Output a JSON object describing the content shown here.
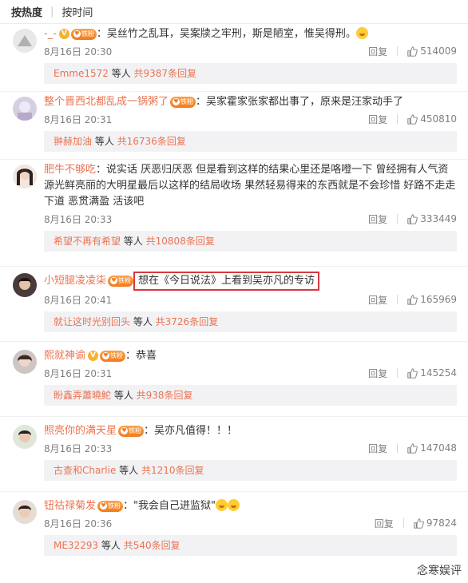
{
  "sort": {
    "hot": "按热度",
    "time": "按时间"
  },
  "comments": [
    {
      "user": "-_-",
      "text": "：吴丝竹之乱耳，吴案牍之牢刑，斯是陋室，惟吴得刑。",
      "time": "8月16日 20:30",
      "reply_label": "回复",
      "likes": "514009",
      "summary": {
        "name": "Emme1572",
        "mid": " 等人 ",
        "link": "共9387条回复"
      }
    },
    {
      "user": "整个晋西北都乱成一锅粥了",
      "text": "：吴家霍家张家都出事了，原来是汪家动手了",
      "time": "8月16日 20:31",
      "reply_label": "回复",
      "likes": "450810",
      "summary": {
        "name": "翀赫加油",
        "mid": " 等人 ",
        "link": "共16736条回复"
      }
    },
    {
      "user": "肥牛不够吃",
      "text": "：说实话 厌恶归厌恶 但是看到这样的结果心里还是咯噔一下 曾经拥有人气资源光鲜亮丽的大明星最后以这样的结局收场 果然轻易得来的东西就是不会珍惜 好路不走走下道 恶贯满盈 活该吧",
      "time": "8月16日 20:33",
      "reply_label": "回复",
      "likes": "333449",
      "summary": {
        "name": "希望不再有希望",
        "mid": " 等人 ",
        "link": "共10808条回复"
      }
    },
    {
      "user": "小短腿凌凌柒",
      "text": "想在《今日说法》上看到吴亦凡的专访",
      "time": "8月16日 20:41",
      "reply_label": "回复",
      "likes": "165969",
      "summary": {
        "name": "就让这时光别回头",
        "mid": " 等人 ",
        "link": "共3726条回复"
      }
    },
    {
      "user": "熙就神谕",
      "text": "：恭喜",
      "time": "8月16日 20:31",
      "reply_label": "回复",
      "likes": "145254",
      "summary": {
        "name": "盼鑫弄蕭曉鮀",
        "mid": " 等人 ",
        "link": "共938条回复"
      }
    },
    {
      "user": "照亮你的满天星",
      "text": "：吴亦凡值得！！！",
      "time": "8月16日 20:33",
      "reply_label": "回复",
      "likes": "147048",
      "summary": {
        "name": "古查和Charlie",
        "mid": " 等人 ",
        "link": "共1210条回复"
      }
    },
    {
      "user": "钮祜禄菊发",
      "text": "：\"我会自己进监狱\"",
      "time": "8月16日 20:36",
      "reply_label": "回复",
      "likes": "97824",
      "summary": {
        "name": "ME32293",
        "mid": " 等人 ",
        "link": "共540条回复"
      }
    }
  ],
  "badge_fan_label": "铁粉",
  "watermark": "念寒娱评",
  "colors": {
    "accent": "#eb7350",
    "highlight": "#d9393e",
    "reply_bg": "#f2f2f5"
  }
}
